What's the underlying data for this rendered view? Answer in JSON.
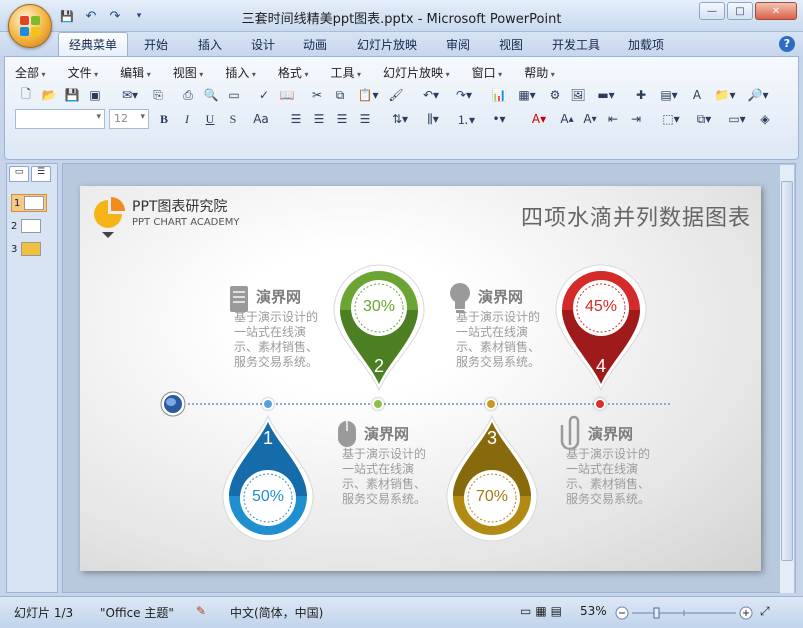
{
  "window": {
    "title": "三套时间线精美ppt图表.pptx - Microsoft PowerPoint",
    "controls": {
      "minimize": "—",
      "maximize": "□",
      "close": "✕"
    }
  },
  "quick_access": {
    "save": "💾",
    "undo": "↶",
    "redo": "↷",
    "customize": "▾"
  },
  "ribbon_tabs": [
    "经典菜单",
    "开始",
    "插入",
    "设计",
    "动画",
    "幻灯片放映",
    "审阅",
    "视图",
    "开发工具",
    "加载项"
  ],
  "active_tab": "经典菜单",
  "classic_menu": [
    "全部",
    "文件",
    "编辑",
    "视图",
    "插入",
    "格式",
    "工具",
    "幻灯片放映",
    "窗口",
    "帮助"
  ],
  "font_controls": {
    "font_name": "",
    "font_size": "12",
    "bold": "B",
    "italic": "I",
    "underline": "U",
    "shadow": "S",
    "case": "Aa"
  },
  "slides_panel": {
    "tabs": [
      "▭",
      "☰"
    ],
    "slides": [
      {
        "number": "1",
        "selected": true
      },
      {
        "number": "2",
        "selected": false
      },
      {
        "number": "3",
        "selected": false
      }
    ]
  },
  "slide": {
    "brand_name": "PPT图表研究院",
    "brand_sub": "PPT CHART ACADEMY",
    "title": "四项水滴并列数据图表",
    "drops": [
      {
        "number": "1",
        "percent": "50%",
        "color": "#1f8fd0",
        "direction": "down"
      },
      {
        "number": "2",
        "percent": "30%",
        "color": "#6aa533",
        "direction": "up"
      },
      {
        "number": "3",
        "percent": "70%",
        "color": "#b08a12",
        "direction": "down"
      },
      {
        "number": "4",
        "percent": "45%",
        "color": "#d42a2a",
        "direction": "up"
      }
    ],
    "text_blocks": [
      {
        "heading": "演界网",
        "body": "基于演示设计的一站式在线演示、素材销售、服务交易系统。",
        "icon": "document-icon"
      },
      {
        "heading": "演界网",
        "body": "基于演示设计的一站式在线演示、素材销售、服务交易系统。",
        "icon": "mouse-icon"
      },
      {
        "heading": "演界网",
        "body": "基于演示设计的一站式在线演示、素材销售、服务交易系统。",
        "icon": "lightbulb-icon"
      },
      {
        "heading": "演界网",
        "body": "基于演示设计的一站式在线演示、素材销售、服务交易系统。",
        "icon": "paperclip-icon"
      }
    ]
  },
  "status": {
    "slide_info": "幻灯片 1/3",
    "theme": "\"Office 主题\"",
    "language": "中文(简体，中国)",
    "zoom": "53%"
  }
}
